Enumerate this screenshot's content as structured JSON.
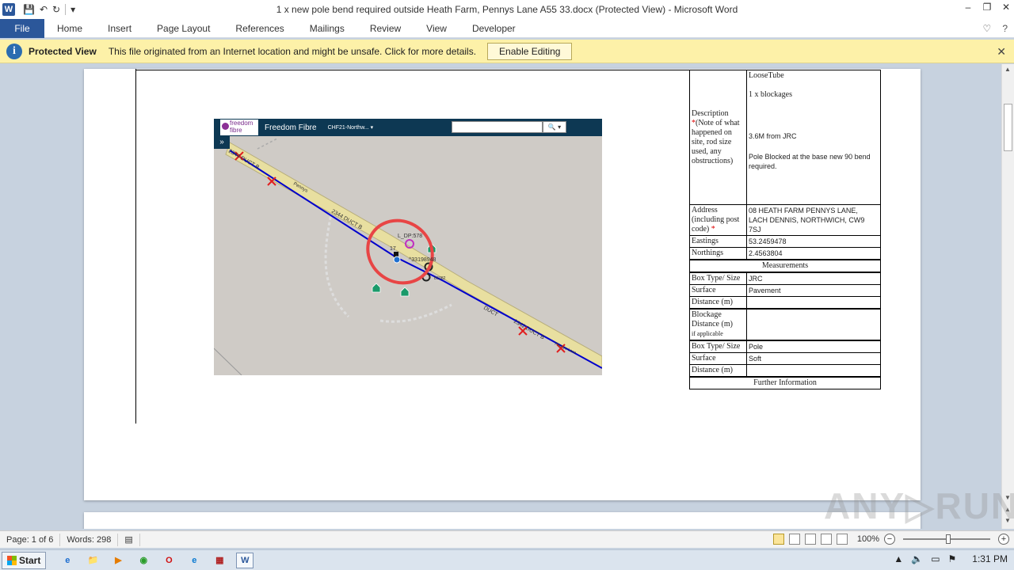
{
  "window": {
    "title": "1 x new pole bend required outside Heath Farm, Pennys Lane A55 33.docx (Protected View)  -  Microsoft Word",
    "app_icon": "W"
  },
  "qat": {
    "save": "💾",
    "undo": "↶",
    "redo": "↻",
    "more": "▾"
  },
  "win_controls": {
    "minimize": "–",
    "restore": "❐",
    "close": "✕"
  },
  "ribbon": {
    "file": "File",
    "tabs": [
      "Home",
      "Insert",
      "Page Layout",
      "References",
      "Mailings",
      "Review",
      "View",
      "Developer"
    ],
    "right_icons": [
      "♡",
      "?"
    ]
  },
  "protected_view": {
    "title": "Protected View",
    "message": "This file originated from an Internet location and might be unsafe. Click for more details.",
    "button": "Enable Editing",
    "close": "✕"
  },
  "map": {
    "brand": "Freedom Fibre",
    "logo_text": "freedom fibre",
    "project": "CHF21-Northw... ▾",
    "search_btn": "🔍 ▾",
    "expand": "»",
    "labels": {
      "duct1": "2344 DUCT B",
      "duct2": "2344 DUCT B",
      "duct3": "2342 DUCT B",
      "duct4": "DUCT",
      "dp": "L_DP:578",
      "node": "^33198948",
      "node2": "17",
      "road": "Pennys Lane",
      "road2": "B5082",
      "road3": "Pennys"
    }
  },
  "table": {
    "description_label": "Description",
    "description_note": "(Note of what happened on site, rod size used, any obstructions)",
    "desc_lines": [
      "LooseTube",
      "1 x blockages",
      "3.6M from JRC",
      "Pole Blocked at the base new 90 bend required."
    ],
    "address_label": "Address (including post code)",
    "address_value": "08 HEATH FARM PENNYS LANE, LACH DENNIS, NORTHWICH, CW9 7SJ",
    "eastings_label": "Eastings",
    "eastings_value": "53.2459478",
    "northings_label": "Northings",
    "northings_value": "2.4563804",
    "measurements": "Measurements",
    "box_type_label": "Box Type/ Size",
    "box_type_value": "JRC",
    "surface_label": "Surface",
    "surface_value": "Pavement",
    "distance_label": "Distance (m)",
    "distance_value": "",
    "blockage_label": "Blockage Distance (m)",
    "blockage_sub": "if applicable",
    "blockage_value": "",
    "box_type2_value": "Pole",
    "surface2_value": "Soft",
    "distance2_value": "",
    "further": "Further Information",
    "asterisk": "*"
  },
  "watermark": "ANY▷RUN",
  "status": {
    "page": "Page: 1 of 6",
    "words": "Words: 298",
    "zoom": "100%",
    "zoom_minus": "−",
    "zoom_plus": "+"
  },
  "taskbar": {
    "start": "Start",
    "clock": "1:31 PM",
    "apps": [
      "e",
      "📁",
      "▶",
      "◉",
      "O",
      "e",
      "▦",
      "W"
    ],
    "tray": [
      "▲",
      "🔈",
      "▭",
      "⚑"
    ]
  },
  "colors": {
    "word_blue": "#2b579a",
    "protected_yellow": "#fdf1a8",
    "map_header": "#0d3853",
    "duct_blue": "#0000cc",
    "road_fill": "#e8dfa0",
    "circle_red": "#e84545"
  }
}
